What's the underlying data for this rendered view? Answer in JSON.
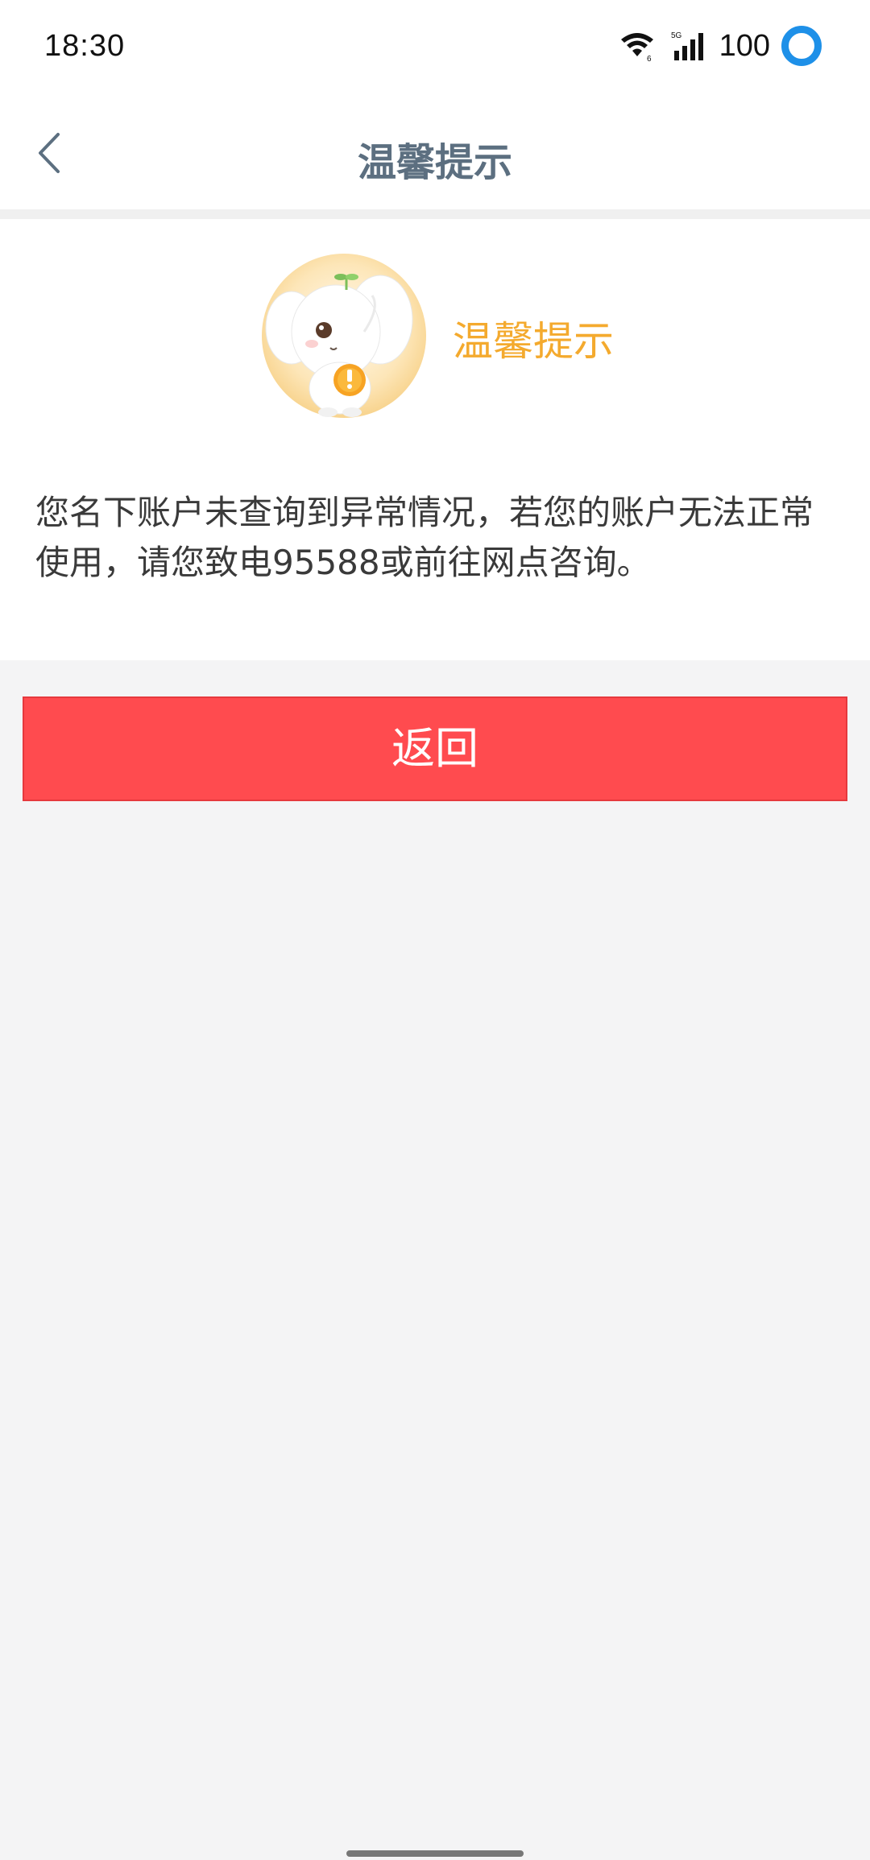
{
  "status_bar": {
    "time": "18:30",
    "network": "5G",
    "battery": "100",
    "icons": [
      "wifi-icon",
      "signal-icon",
      "ring-icon"
    ]
  },
  "header": {
    "title": "温馨提示",
    "back_icon": "chevron-left-icon"
  },
  "tip": {
    "mascot_icon": "elephant-mascot-icon",
    "heading": "温馨提示",
    "message": "您名下账户未查询到异常情况，若您的账户无法正常使用，请您致电95588或前往网点咨询。"
  },
  "actions": {
    "return_label": "返回"
  },
  "colors": {
    "accent_red": "#ff4b4f",
    "heading_orange": "#f4aa2e",
    "title_gray": "#5c6f80",
    "status_ring_blue": "#1e90e8"
  }
}
